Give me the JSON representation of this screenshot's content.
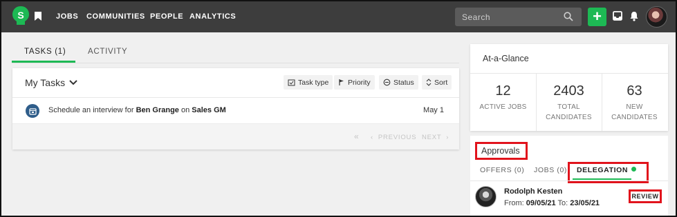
{
  "nav": {
    "logo_letter": "S",
    "items": [
      "JOBS",
      "COMMUNITIES",
      "PEOPLE",
      "ANALYTICS"
    ],
    "search_placeholder": "Search",
    "add_label": "+"
  },
  "tabs": {
    "items": [
      "TASKS (1)",
      "ACTIVITY"
    ],
    "active": "TASKS (1)"
  },
  "tasks": {
    "dropdown_label": "My Tasks",
    "filters": [
      "Task type",
      "Priority",
      "Status",
      "Sort"
    ],
    "items": [
      {
        "prefix": "Schedule an interview for ",
        "candidate": "Ben Grange",
        "middle": " on ",
        "job": "Sales GM",
        "date": "May 1"
      }
    ],
    "pager": {
      "first": "«",
      "previous": "‹  PREVIOUS",
      "next": "NEXT  ›"
    }
  },
  "glance": {
    "title": "At-a-Glance",
    "stats": [
      {
        "value": "12",
        "label_line1": "ACTIVE JOBS",
        "label_line2": ""
      },
      {
        "value": "2403",
        "label_line1": "TOTAL",
        "label_line2": "CANDIDATES"
      },
      {
        "value": "63",
        "label_line1": "NEW",
        "label_line2": "CANDIDATES"
      }
    ]
  },
  "approvals": {
    "title": "Approvals",
    "tabs": [
      "OFFERS (0)",
      "JOBS (0)",
      "DELEGATION"
    ],
    "active_tab": "DELEGATION",
    "delegation": {
      "name": "Rodolph Kesten",
      "from_label": "From:",
      "from_date": "09/05/21",
      "to_label": "To:",
      "to_date": "23/05/21",
      "action_label": "REVIEW"
    }
  },
  "colors": {
    "brand": "#1db954",
    "topbar": "#3d3d3d",
    "highlight": "#e1131c",
    "task_icon": "#2f5d8a"
  }
}
